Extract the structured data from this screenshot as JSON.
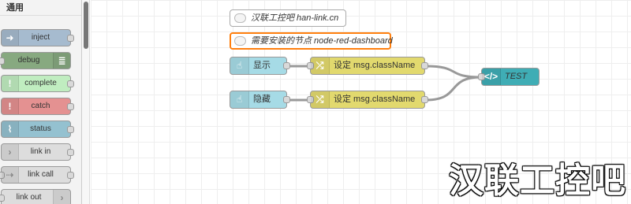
{
  "palette": {
    "category": "通用",
    "nodes": [
      {
        "label": "inject",
        "icon": "arrow-right-icon",
        "color": "#a6bbcf"
      },
      {
        "label": "debug",
        "icon": "list-icon",
        "color": "#87a980"
      },
      {
        "label": "complete",
        "icon": "exclamation-icon",
        "color": "#c0edc0"
      },
      {
        "label": "catch",
        "icon": "exclamation-icon",
        "color": "#e49191"
      },
      {
        "label": "status",
        "icon": "pulse-icon",
        "color": "#94c1d0"
      },
      {
        "label": "link in",
        "icon": "link-icon",
        "color": "#dddddd"
      },
      {
        "label": "link call",
        "icon": "link-call-icon",
        "color": "#dddddd"
      },
      {
        "label": "link out",
        "icon": "link-icon",
        "color": "#dddddd"
      }
    ]
  },
  "flow": {
    "comments": [
      {
        "text": "汉联工控吧 han-link.cn"
      },
      {
        "text": "需要安装的节点 node-red-dashboard"
      }
    ],
    "nodes": {
      "show": {
        "label": "显示",
        "icon": "hand-pointer-icon",
        "color": "#a6dbe6"
      },
      "hide": {
        "label": "隐藏",
        "icon": "hand-pointer-icon",
        "color": "#a6dbe6"
      },
      "change1": {
        "label": "设定 msg.className",
        "icon": "shuffle-icon",
        "color": "#e2d96e"
      },
      "change2": {
        "label": "设定 msg.className",
        "icon": "shuffle-icon",
        "color": "#e2d96e"
      },
      "template": {
        "label": "TEST",
        "icon": "code-icon",
        "color": "#3fadb5"
      }
    }
  },
  "watermark": "汉联工控吧"
}
